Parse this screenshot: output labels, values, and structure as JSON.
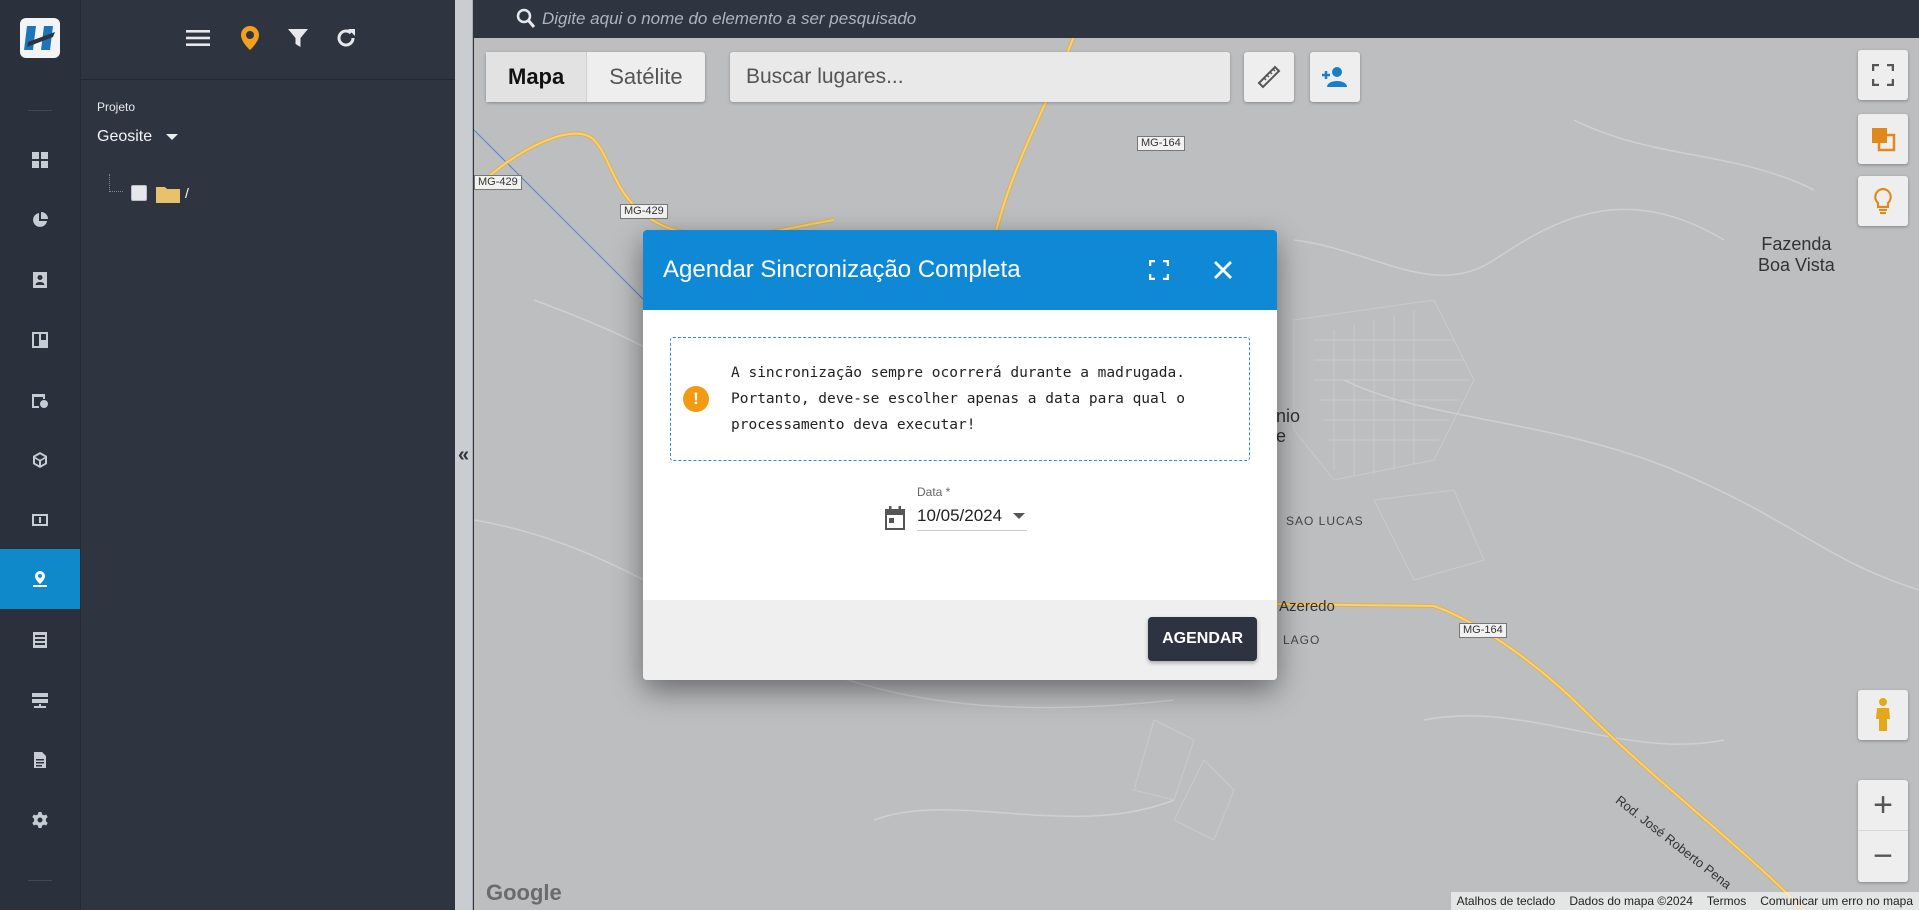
{
  "search": {
    "placeholder": "Digite aqui o nome do elemento a ser pesquisado"
  },
  "panel": {
    "project_label": "Projeto",
    "project_value": "Geosite",
    "tree_root": "/"
  },
  "rail": {
    "items": [
      "dashboard-icon",
      "pie-chart-icon",
      "contact-card-icon",
      "board-icon",
      "calendar-clock-icon",
      "cube-icon",
      "money-icon",
      "map-pin-icon",
      "list-icon",
      "server-icon",
      "document-icon",
      "gear-icon"
    ],
    "active_index": 7,
    "accent": "#0f89c9"
  },
  "map": {
    "type_map": "Mapa",
    "type_satellite": "Satélite",
    "places_placeholder": "Buscar lugares...",
    "roads": [
      "MG-164",
      "MG-429",
      "MG-429",
      "MG-164"
    ],
    "places": {
      "fazenda_line1": "Fazenda",
      "fazenda_line2": "Boa Vista",
      "sao_lucas": "SAO LUCAS",
      "azeredo": "Azeredo",
      "lago": "LAGO",
      "partial_1": "nio",
      "partial_2": "e",
      "rod": "Rod. José Roberto Pena"
    },
    "google": "Google",
    "attribution": [
      "Atalhos de teclado",
      "Dados do mapa ©2024",
      "Termos",
      "Comunicar um erro no mapa"
    ]
  },
  "dialog": {
    "title": "Agendar Sincronização Completa",
    "notice": "A sincronização sempre ocorrerá durante a madrugada. Portanto, deve-se escolher apenas a data para qual o processamento deva executar!",
    "date_label": "Data *",
    "date_value": "10/05/2024",
    "submit_label": "AGENDAR",
    "header_color": "#0f89d6"
  }
}
